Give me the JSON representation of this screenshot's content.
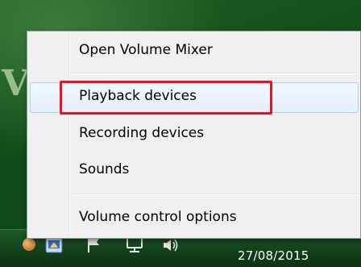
{
  "desktop": {
    "background_color": "#1a5621",
    "partial_letter": "V"
  },
  "context_menu": {
    "items": [
      {
        "label": "Open Volume Mixer"
      },
      {
        "label": "Playback devices"
      },
      {
        "label": "Recording devices"
      },
      {
        "label": "Sounds"
      },
      {
        "label": "Volume control options"
      }
    ],
    "hovered_item": "Playback devices",
    "hover_color": "#aecff7",
    "callout_color": "#e8141a"
  },
  "taskbar": {
    "tray_icons": [
      "app-orange-icon",
      "action-center-shield-icon",
      "flag-icon",
      "network-icon",
      "speaker-icon"
    ],
    "clock_date": "27/08/2015"
  }
}
